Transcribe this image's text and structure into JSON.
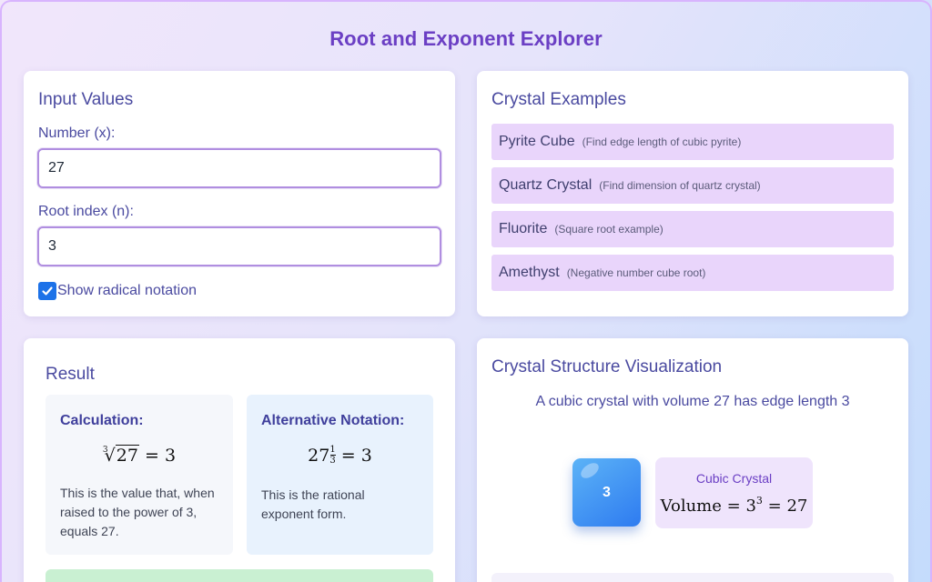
{
  "app": {
    "title": "Root and Exponent Explorer"
  },
  "input_card": {
    "title": "Input Values",
    "number_label": "Number (x):",
    "number_value": "27",
    "root_label": "Root index (n):",
    "root_value": "3",
    "radical_checkbox_label": "Show radical notation",
    "radical_checked": true
  },
  "examples_card": {
    "title": "Crystal Examples",
    "items": [
      {
        "name": "Pyrite Cube",
        "desc": "(Find edge length of cubic pyrite)"
      },
      {
        "name": "Quartz Crystal",
        "desc": "(Find dimension of quartz crystal)"
      },
      {
        "name": "Fluorite",
        "desc": "(Square root example)"
      },
      {
        "name": "Amethyst",
        "desc": "(Negative number cube root)"
      }
    ]
  },
  "result_card": {
    "title": "Result",
    "calculation": {
      "title": "Calculation:",
      "index": "3",
      "radicand": "27",
      "result": "3",
      "text": "This is the value that, when raised to the power of 3, equals 27."
    },
    "alternative": {
      "title": "Alternative Notation:",
      "base": "27",
      "exp_num": "1",
      "exp_den": "3",
      "result": "3",
      "text": "This is the rational exponent form."
    }
  },
  "viz_card": {
    "title": "Crystal Structure Visualization",
    "caption": "A cubic crystal with volume 27 has edge length 3",
    "cube_label": "3",
    "info_title": "Cubic Crystal",
    "volume_word": "Volume",
    "volume_base": "3",
    "volume_exp": "3",
    "volume_value": "27"
  },
  "colors": {
    "accent": "#6b3fc4",
    "heading": "#4a4aa0",
    "input_border": "#b08ee0",
    "example_bg": "#e9d5fb",
    "cube_blue": "#2e7bf0",
    "checkbox": "#1d72e8"
  }
}
